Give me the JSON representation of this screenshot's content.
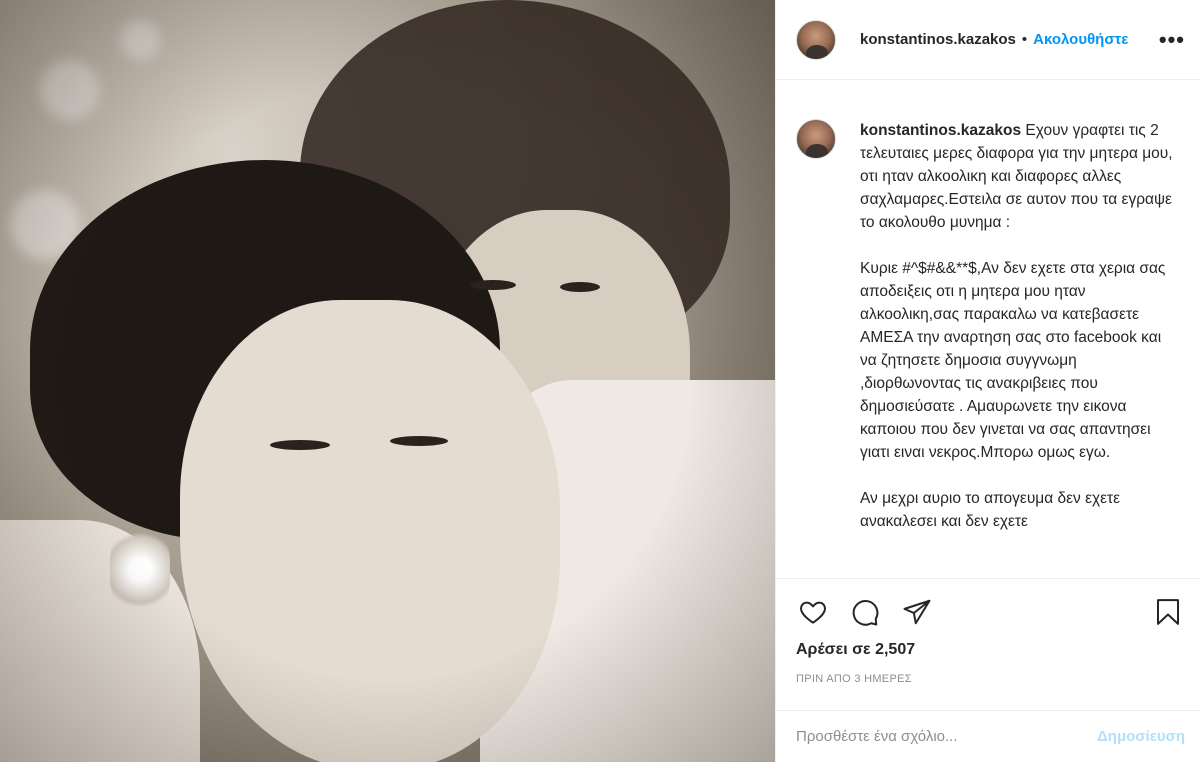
{
  "photo": {
    "alt_semantics": "photo-content"
  },
  "header": {
    "username": "konstantinos.kazakos",
    "separator": "•",
    "follow_label": "Ακολουθήστε",
    "more_label": "•••"
  },
  "caption": {
    "username": "konstantinos.kazakos",
    "text": " Εχουν γραφτει τις 2 τελευταιες μερες διαφορα για την μητερα μου, οτι ηταν αλκοολικη και διαφορες αλλες σαχλαμαρες.Εστειλα σε αυτον που τα εγραψε το ακολουθο μυνημα :\n\nΚυριε #^$#&&**$,Αν δεν εχετε στα χερια σας αποδειξεις οτι η μητερα μου ηταν αλκοολικη,σας παρακαλω να κατεβασετε ΑΜΕΣΑ την αναρτηση σας στο facebook και να ζητησετε δημοσια συγγνωμη ,διορθωνοντας τις ανακριβειες που δημοσιεύσατε . Αμαυρωνετε την εικονα καποιου που δεν γινεται να σας απαντησει γιατι ειναι νεκρος.Μπορω ομως εγω.\n\nΑν μεχρι αυριο το απογευμα δεν εχετε ανακαλεσει και δεν εχετε"
  },
  "actions": {
    "icons": [
      "heart-icon",
      "comment-icon",
      "share-icon",
      "bookmark-icon"
    ],
    "likes_label": "Αρέσει σε 2,507",
    "timestamp": "ΠΡΙΝ ΑΠΟ 3 ΗΜΕΡΕΣ"
  },
  "comment": {
    "placeholder": "Προσθέστε ένα σχόλιο...",
    "post_label": "Δημοσίευση"
  },
  "colors": {
    "accent": "#0095f6",
    "post_disabled": "#b2dffc",
    "text": "#262626",
    "muted": "#8e8e8e",
    "divider": "#efefef"
  }
}
